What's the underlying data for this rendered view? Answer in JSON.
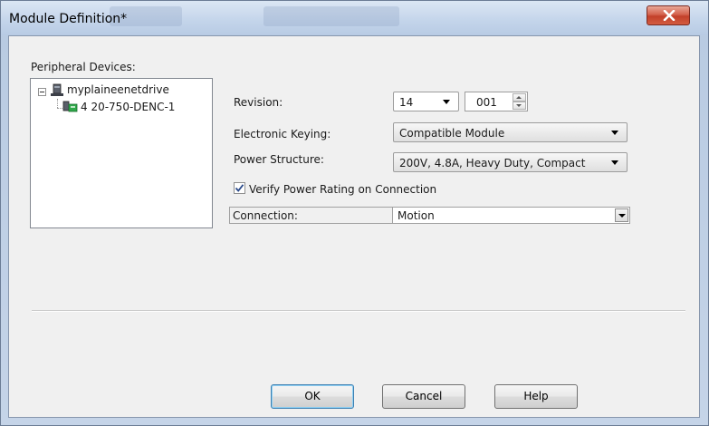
{
  "window": {
    "title": "Module Definition*",
    "close_icon": "close-icon"
  },
  "peripheral": {
    "label": "Peripheral Devices:",
    "tree": [
      {
        "label": "myplaineenetdrive",
        "icon": "network-device-icon",
        "expanded": true
      },
      {
        "label": "4 20-750-DENC-1",
        "icon": "encoder-module-icon"
      }
    ]
  },
  "form": {
    "revision": {
      "label": "Revision:",
      "major": "14",
      "minor": "001"
    },
    "keying": {
      "label": "Electronic Keying:",
      "value": "Compatible Module"
    },
    "power": {
      "label": "Power Structure:",
      "value": "200V, 4.8A, Heavy Duty, Compact"
    },
    "verify": {
      "label": "Verify Power Rating on Connection",
      "checked": true
    },
    "connection": {
      "label": "Connection:",
      "value": "Motion"
    }
  },
  "buttons": {
    "ok": "OK",
    "cancel": "Cancel",
    "help": "Help"
  },
  "colors": {
    "close": "#c2402a",
    "title_bar": "#c3d4ea",
    "client": "#f0f0f0"
  }
}
